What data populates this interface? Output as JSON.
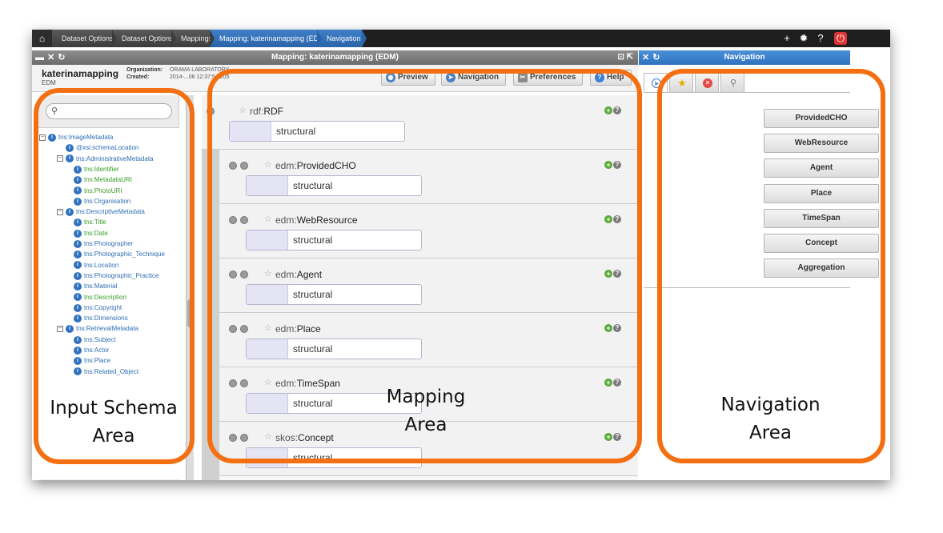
{
  "breadcrumbs": [
    "Dataset Options",
    "Dataset Options",
    "Mappings",
    "Mapping: katerinamapping (EDM)",
    "Navigation"
  ],
  "top_icons": [
    "plus-icon",
    "gear-icon",
    "help-icon",
    "power-icon"
  ],
  "mapping_header": {
    "title": "Mapping: katerinamapping (EDM)"
  },
  "navigation_header": {
    "title": "Navigation"
  },
  "info": {
    "name": "katerinamapping",
    "type": "EDM",
    "organization_label": "Organization:",
    "organization_value": "ORAMA LABORATORY",
    "created_label": "Created:",
    "created_value": "2014-...06 12:37:54.205"
  },
  "toolbar": {
    "preview": "Preview",
    "navigation": "Navigation",
    "preferences": "Preferences",
    "help": "Help"
  },
  "schema_tree": [
    {
      "label": "tns:ImageMetadata",
      "level": 0,
      "toggle": "⊟",
      "leaf": false
    },
    {
      "label": "@xsi:schemaLocation",
      "level": 1,
      "toggle": "",
      "leaf": false
    },
    {
      "label": "tns:AdministrativeMetadata",
      "level": 1,
      "toggle": "⊟",
      "leaf": false
    },
    {
      "label": "tns:Identifier",
      "level": 2,
      "toggle": "",
      "leaf": true
    },
    {
      "label": "tns:MetadataURI",
      "level": 2,
      "toggle": "",
      "leaf": true
    },
    {
      "label": "tns:PhotoURI",
      "level": 2,
      "toggle": "",
      "leaf": true
    },
    {
      "label": "tns:Organisation",
      "level": 2,
      "toggle": "",
      "leaf": false
    },
    {
      "label": "tns:DescriptiveMetadata",
      "level": 1,
      "toggle": "⊟",
      "leaf": false
    },
    {
      "label": "tns:Title",
      "level": 2,
      "toggle": "",
      "leaf": true
    },
    {
      "label": "tns:Date",
      "level": 2,
      "toggle": "",
      "leaf": true
    },
    {
      "label": "tns:Photographer",
      "level": 2,
      "toggle": "",
      "leaf": false
    },
    {
      "label": "tns:Photographic_Technique",
      "level": 2,
      "toggle": "",
      "leaf": false
    },
    {
      "label": "tns:Location",
      "level": 2,
      "toggle": "",
      "leaf": false
    },
    {
      "label": "tns:Photographic_Practice",
      "level": 2,
      "toggle": "",
      "leaf": false
    },
    {
      "label": "tns:Material",
      "level": 2,
      "toggle": "",
      "leaf": false
    },
    {
      "label": "tns:Description",
      "level": 2,
      "toggle": "",
      "leaf": true
    },
    {
      "label": "tns:Copyright",
      "level": 2,
      "toggle": "",
      "leaf": false
    },
    {
      "label": "tns:Dimensions",
      "level": 2,
      "toggle": "",
      "leaf": false
    },
    {
      "label": "tns:RetrievalMetadata",
      "level": 1,
      "toggle": "⊟",
      "leaf": false
    },
    {
      "label": "tns:Subject",
      "level": 2,
      "toggle": "",
      "leaf": false
    },
    {
      "label": "tns:Actor",
      "level": 2,
      "toggle": "",
      "leaf": false
    },
    {
      "label": "tns:Place",
      "level": 2,
      "toggle": "",
      "leaf": false
    },
    {
      "label": "tns:Related_Object",
      "level": 2,
      "toggle": "",
      "leaf": false
    }
  ],
  "mapping_rows": [
    {
      "prefix": "rdf:",
      "name": "RDF",
      "value": "structural"
    },
    {
      "prefix": "edm:",
      "name": "ProvidedCHO",
      "value": "structural"
    },
    {
      "prefix": "edm:",
      "name": "WebResource",
      "value": "structural"
    },
    {
      "prefix": "edm:",
      "name": "Agent",
      "value": "structural"
    },
    {
      "prefix": "edm:",
      "name": "Place",
      "value": "structural"
    },
    {
      "prefix": "edm:",
      "name": "TimeSpan",
      "value": "structural"
    },
    {
      "prefix": "skos:",
      "name": "Concept",
      "value": "structural"
    }
  ],
  "navigation_buttons": [
    "ProvidedCHO",
    "WebResource",
    "Agent",
    "Place",
    "TimeSpan",
    "Concept",
    "Aggregation"
  ],
  "annotations": {
    "input": "Input Schema Area",
    "input_line1": "Input Schema",
    "input_line2": "Area",
    "mapping_line1": "Mapping",
    "mapping_line2": "Area",
    "navigation_line1": "Navigation",
    "navigation_line2": "Area"
  },
  "colors": {
    "accent": "#2f72bf",
    "annotation_outline": "#f36f12"
  }
}
